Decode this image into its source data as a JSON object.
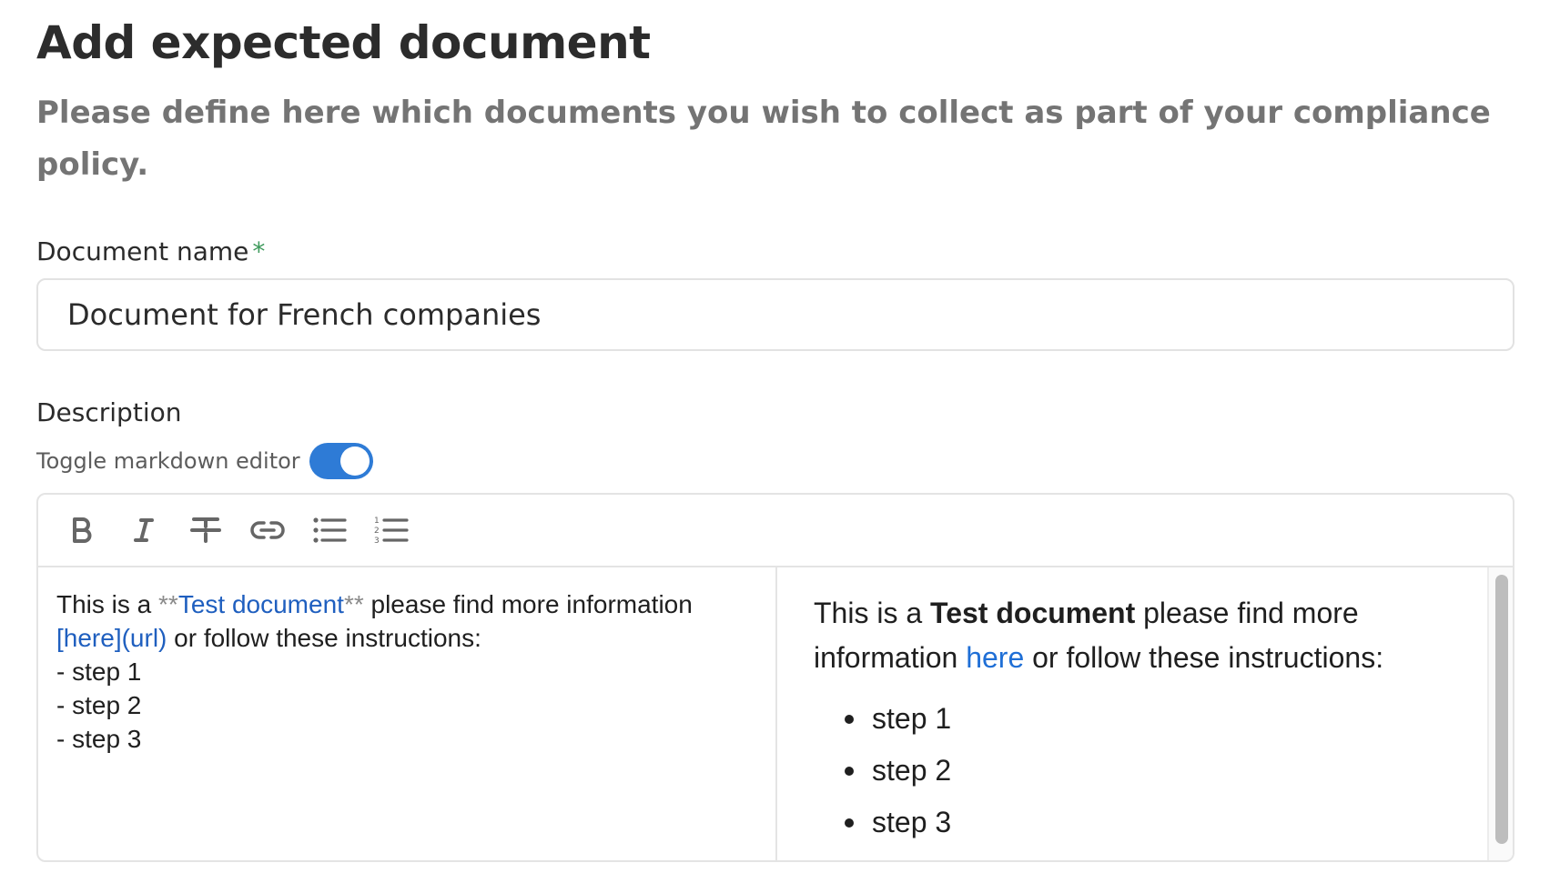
{
  "header": {
    "title": "Add expected document",
    "subtitle": "Please define here which documents you wish to collect as part of your compliance policy."
  },
  "document_name": {
    "label": "Document name",
    "required_mark": "*",
    "value": "Document for French companies"
  },
  "description": {
    "label": "Description",
    "toggle_label": "Toggle markdown editor",
    "toggle_on": true
  },
  "toolbar": {
    "buttons": [
      {
        "name": "bold-icon",
        "label": "Bold"
      },
      {
        "name": "italic-icon",
        "label": "Italic"
      },
      {
        "name": "strikethrough-icon",
        "label": "Strikethrough"
      },
      {
        "name": "link-icon",
        "label": "Link"
      },
      {
        "name": "bullet-list-icon",
        "label": "Bulleted list"
      },
      {
        "name": "numbered-list-icon",
        "label": "Numbered list"
      }
    ]
  },
  "markdown_source": {
    "line1_prefix": "This is a ",
    "bold_open": "**",
    "bold_text": "Test document",
    "bold_close": "**",
    "line1_suffix": " please find more information",
    "link_md": "[here](url)",
    "line2_suffix": " or follow these instructions:",
    "steps": [
      "- step 1",
      "- step 2",
      "- step 3"
    ]
  },
  "preview": {
    "prefix": "This is a ",
    "bold": "Test document",
    "middle": " please find more information ",
    "link": "here",
    "suffix": " or follow these instructions:",
    "steps": [
      "step 1",
      "step 2",
      "step 3"
    ]
  },
  "colors": {
    "accent": "#2e7bd6",
    "link": "#1f6fd6",
    "required": "#3e9a5c"
  }
}
